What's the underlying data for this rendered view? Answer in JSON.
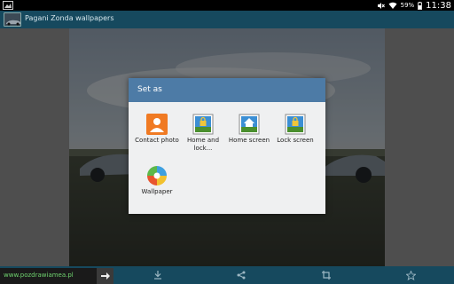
{
  "status_bar": {
    "battery": "59%",
    "time": "11:38"
  },
  "action_bar": {
    "title": "Pagani Zonda wallpapers"
  },
  "dialog": {
    "title": "Set as",
    "options": [
      {
        "label": "Contact photo",
        "icon": "contact-photo-icon"
      },
      {
        "label": "Home and lock...",
        "icon": "home-lock-screen-icon"
      },
      {
        "label": "Home screen",
        "icon": "home-screen-icon"
      },
      {
        "label": "Lock screen",
        "icon": "lock-screen-icon"
      },
      {
        "label": "Wallpaper",
        "icon": "wallpaper-app-icon"
      }
    ]
  },
  "ad": {
    "text": "www.pozdrawiamea.pl"
  },
  "bottom_bar": {
    "actions": [
      "download-icon",
      "share-icon",
      "crop-icon",
      "star-icon"
    ]
  },
  "colors": {
    "action_bar": "#16495e",
    "dialog_header": "#4d7ba6",
    "dialog_body": "#eff0f1",
    "ad_text": "#6fd36f"
  }
}
